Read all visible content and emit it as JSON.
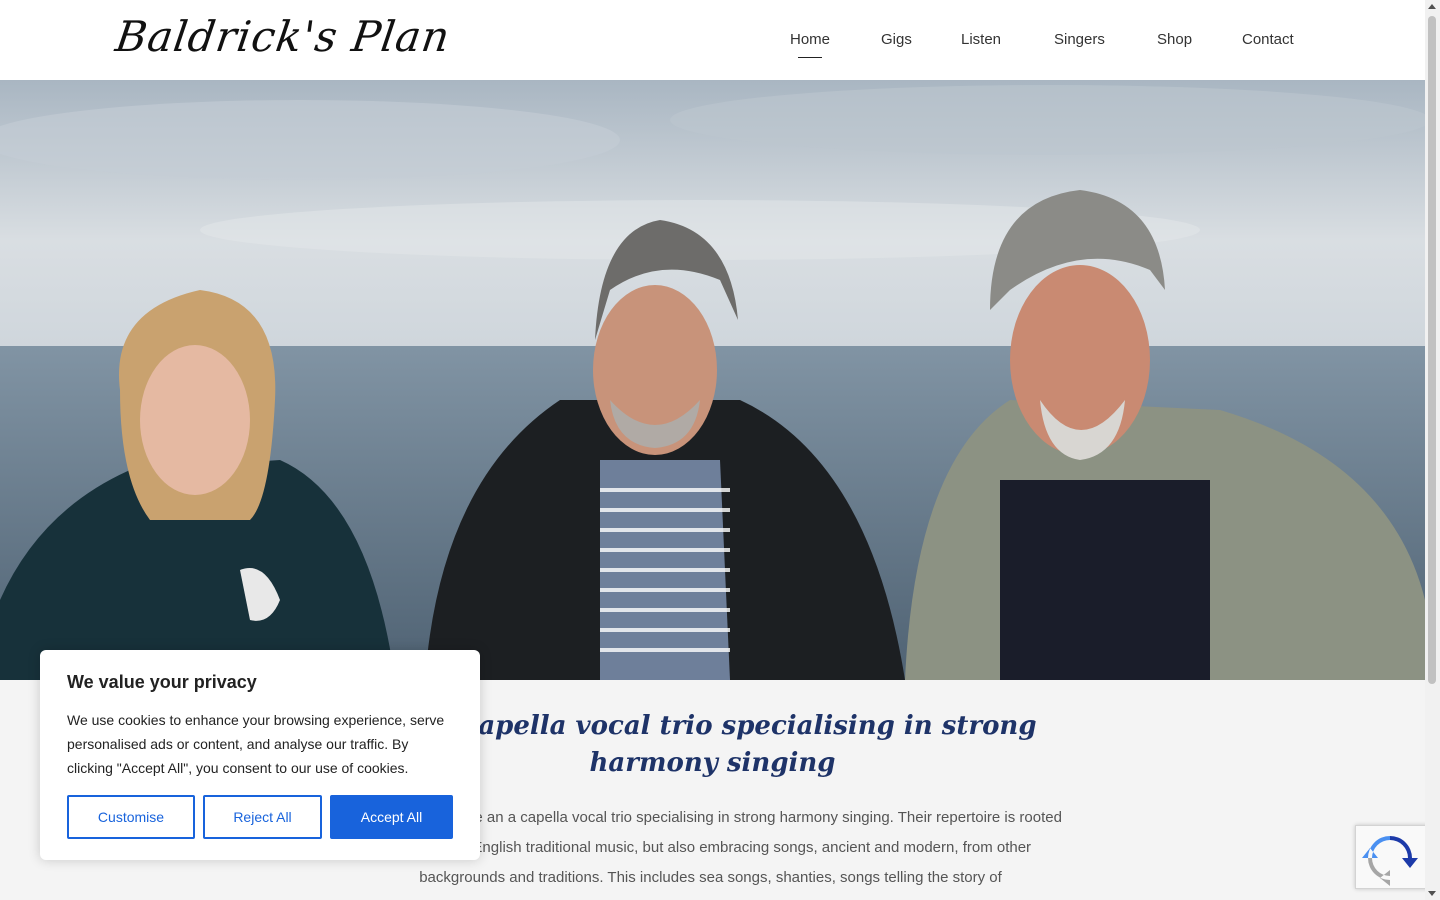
{
  "site": {
    "logo_text": "Baldrick's Plan"
  },
  "nav": {
    "items": [
      {
        "label": "Home",
        "active": true
      },
      {
        "label": "Gigs",
        "active": false
      },
      {
        "label": "Listen",
        "active": false
      },
      {
        "label": "Singers",
        "active": false
      },
      {
        "label": "Shop",
        "active": false
      },
      {
        "label": "Contact",
        "active": false
      }
    ]
  },
  "hero": {
    "image_alt": "Three singers standing in front of the sea"
  },
  "content": {
    "heading": "An a capella vocal trio specialising in strong harmony singing",
    "body": "Baldrick's Plan are an a capella vocal trio specialising in strong harmony singing. Their repertoire is rooted firmly within English traditional music, but also embracing songs, ancient and modern, from other backgrounds and traditions. This includes sea songs, shanties, songs telling the story of"
  },
  "cookie_banner": {
    "title": "We value your privacy",
    "text": "We use cookies to enhance your browsing experience, serve personalised ads or content, and analyse our traffic. By clicking \"Accept All\", you consent to our use of cookies.",
    "customise_label": "Customise",
    "reject_label": "Reject All",
    "accept_label": "Accept All"
  },
  "colors": {
    "accent": "#1863dc",
    "heading": "#1e3368"
  }
}
